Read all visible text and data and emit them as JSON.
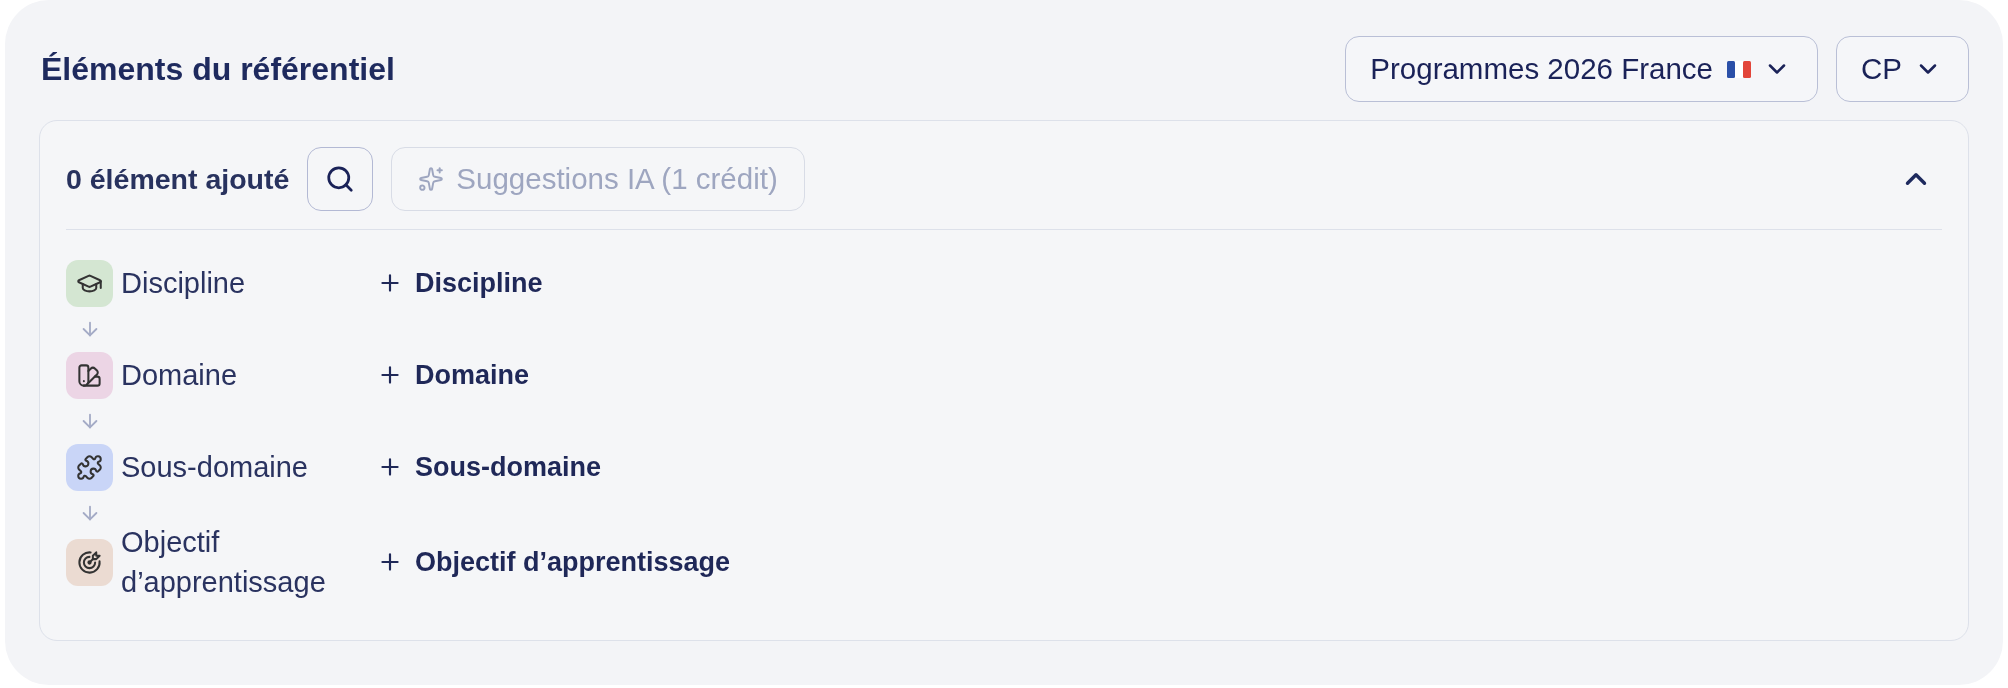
{
  "header": {
    "title": "Éléments du référentiel",
    "dropdowns": [
      {
        "label": "Programmes 2026 France",
        "flag": true
      },
      {
        "label": "CP",
        "flag": false
      }
    ]
  },
  "panel": {
    "count_label": "0 élément ajouté",
    "suggestions": {
      "label": "Suggestions IA (1 crédit)",
      "disabled": true
    },
    "expanded": true,
    "levels": [
      {
        "kind": "discipline",
        "label": "Discipline",
        "color": "#d4e6d2",
        "add_label": "Discipline"
      },
      {
        "kind": "domain",
        "label": "Domaine",
        "color": "#ecd5e5",
        "add_label": "Domaine"
      },
      {
        "kind": "subdomain",
        "label": "Sous-domaine",
        "color": "#c9d5f7",
        "add_label": "Sous-domaine"
      },
      {
        "kind": "objective",
        "label": "Objectif d’apprentissage",
        "color": "#ebdbd2",
        "add_label": "Objectif d’apprentissage"
      }
    ]
  }
}
